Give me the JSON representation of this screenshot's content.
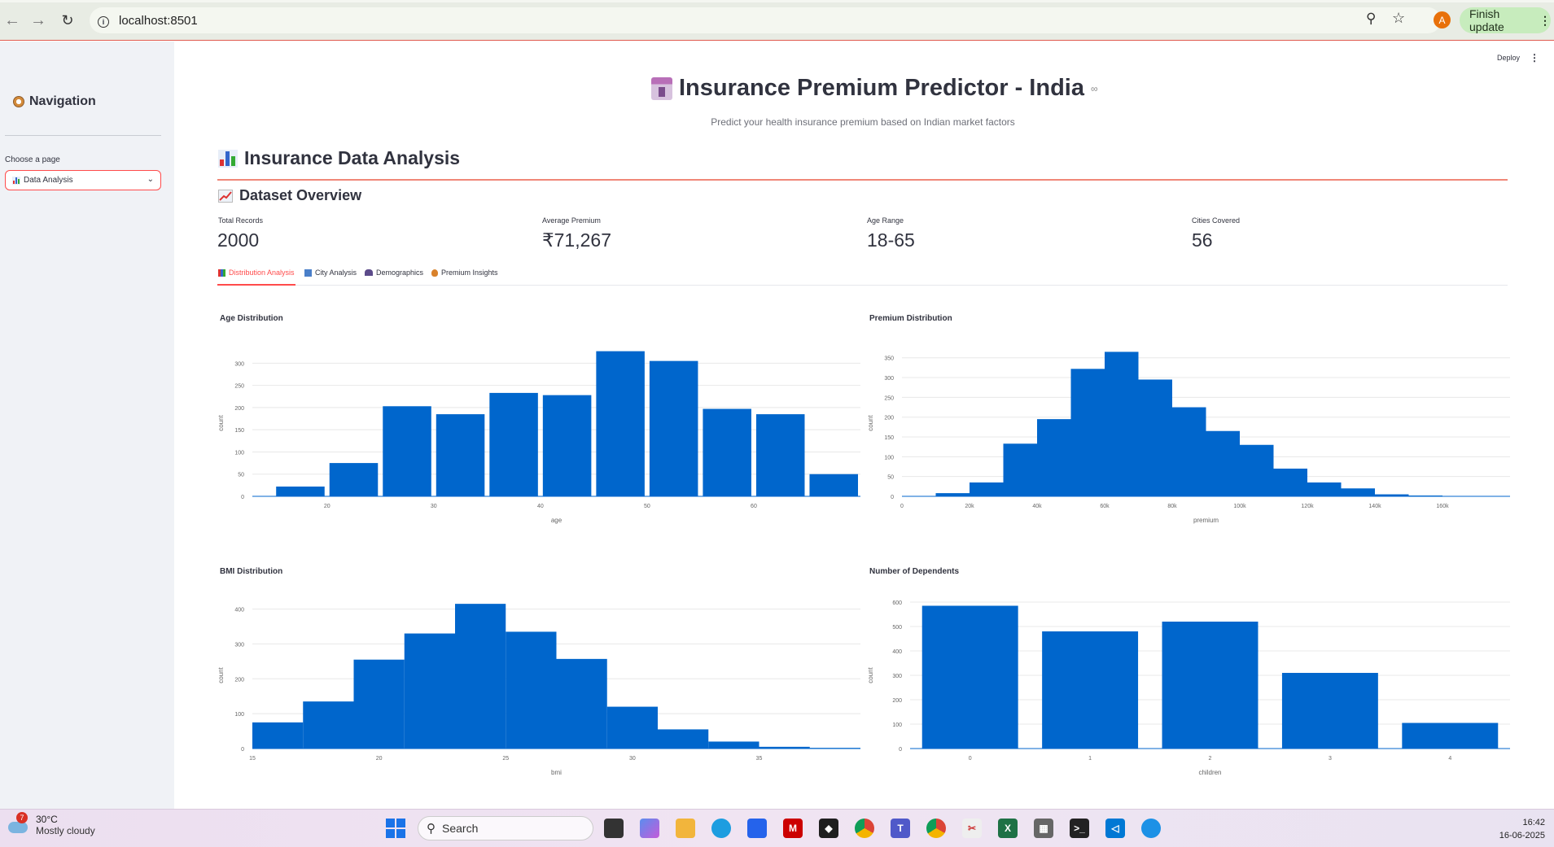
{
  "browser": {
    "url": "localhost:8501",
    "finish_update": "Finish update",
    "avatar_letter": "A"
  },
  "sidebar": {
    "title": "Navigation",
    "choose_label": "Choose a page",
    "selected_page": "Data Analysis"
  },
  "header": {
    "deploy": "Deploy",
    "title": "Insurance Premium Predictor - India",
    "subtitle": "Predict your health insurance premium based on Indian market factors"
  },
  "analysis": {
    "heading": "Insurance Data Analysis",
    "overview_heading": "Dataset Overview",
    "metrics": [
      {
        "label": "Total Records",
        "value": "2000"
      },
      {
        "label": "Average Premium",
        "value": "₹71,267"
      },
      {
        "label": "Age Range",
        "value": "18-65"
      },
      {
        "label": "Cities Covered",
        "value": "56"
      }
    ],
    "tabs": [
      {
        "label": "Distribution Analysis",
        "active": true
      },
      {
        "label": "City Analysis",
        "active": false
      },
      {
        "label": "Demographics",
        "active": false
      },
      {
        "label": "Premium Insights",
        "active": false
      }
    ]
  },
  "chart_data": [
    {
      "type": "bar",
      "title": "Age Distribution",
      "xlabel": "age",
      "ylabel": "count",
      "bin_edges": [
        15,
        20,
        25,
        30,
        35,
        40,
        45,
        50,
        55,
        60,
        65,
        70
      ],
      "values": [
        22,
        75,
        203,
        185,
        233,
        228,
        327,
        305,
        197,
        185,
        50
      ],
      "xticks": [
        20,
        30,
        40,
        50,
        60
      ],
      "yticks": [
        0,
        50,
        100,
        150,
        200,
        250,
        300
      ],
      "xlim": [
        13,
        70
      ],
      "ylim": [
        0,
        330
      ],
      "color": "#0066cc"
    },
    {
      "type": "bar",
      "title": "Premium Distribution",
      "xlabel": "premium",
      "ylabel": "count",
      "bin_edges": [
        0,
        10000,
        20000,
        30000,
        40000,
        50000,
        60000,
        70000,
        80000,
        90000,
        100000,
        110000,
        120000,
        130000,
        140000,
        150000,
        160000,
        170000,
        180000
      ],
      "values": [
        1,
        8,
        35,
        133,
        195,
        322,
        365,
        295,
        225,
        165,
        130,
        70,
        35,
        20,
        5,
        2,
        1,
        0
      ],
      "xticks": [
        0,
        20000,
        40000,
        60000,
        80000,
        100000,
        120000,
        140000,
        160000
      ],
      "xtick_labels": [
        "0",
        "20k",
        "40k",
        "60k",
        "80k",
        "100k",
        "120k",
        "140k",
        "160k"
      ],
      "yticks": [
        0,
        50,
        100,
        150,
        200,
        250,
        300,
        350
      ],
      "xlim": [
        0,
        180000
      ],
      "ylim": [
        0,
        370
      ],
      "color": "#0066cc"
    },
    {
      "type": "bar",
      "title": "BMI Distribution",
      "xlabel": "bmi",
      "ylabel": "count",
      "bin_edges": [
        15,
        17,
        19,
        21,
        23,
        25,
        27,
        29,
        31,
        33,
        35,
        37,
        39
      ],
      "values": [
        75,
        135,
        255,
        330,
        415,
        335,
        257,
        120,
        55,
        20,
        5,
        2
      ],
      "xticks": [
        15,
        20,
        25,
        30,
        35
      ],
      "yticks": [
        0,
        100,
        200,
        300,
        400
      ],
      "xlim": [
        15,
        39
      ],
      "ylim": [
        0,
        420
      ],
      "color": "#0066cc"
    },
    {
      "type": "bar",
      "title": "Number of Dependents",
      "xlabel": "children",
      "ylabel": "count",
      "categories": [
        "0",
        "1",
        "2",
        "3",
        "4"
      ],
      "values": [
        585,
        480,
        520,
        310,
        105
      ],
      "yticks": [
        0,
        100,
        200,
        300,
        400,
        500,
        600
      ],
      "ylim": [
        0,
        600
      ],
      "color": "#0066cc"
    }
  ],
  "taskbar": {
    "temp": "30°C",
    "weather": "Mostly cloudy",
    "weather_badge": "7",
    "search": "Search",
    "time": "16:42",
    "date": "16-06-2025"
  }
}
